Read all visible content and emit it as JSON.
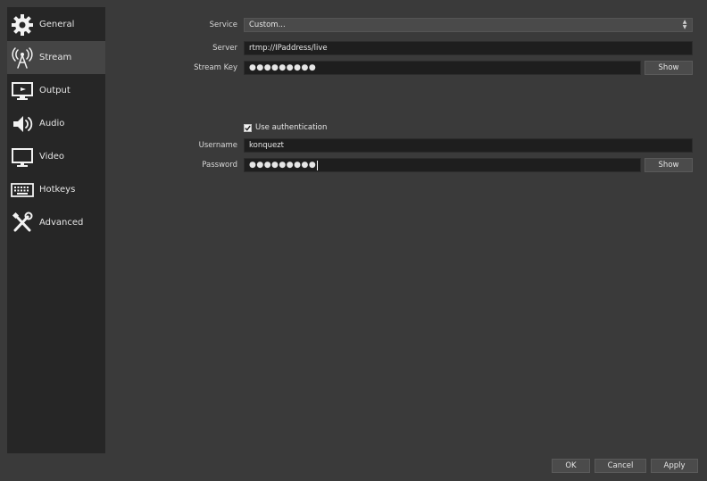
{
  "sidebar": {
    "items": [
      {
        "label": "General",
        "icon": "gear-icon"
      },
      {
        "label": "Stream",
        "icon": "antenna-icon"
      },
      {
        "label": "Output",
        "icon": "monitor-output-icon"
      },
      {
        "label": "Audio",
        "icon": "speaker-icon"
      },
      {
        "label": "Video",
        "icon": "monitor-icon"
      },
      {
        "label": "Hotkeys",
        "icon": "keyboard-icon"
      },
      {
        "label": "Advanced",
        "icon": "tools-icon"
      }
    ],
    "active": "Stream"
  },
  "stream": {
    "service_label": "Service",
    "service_value": "Custom...",
    "server_label": "Server",
    "server_value": "rtmp://IPaddress/live",
    "stream_key_label": "Stream Key",
    "stream_key_value": "●●●●●●●●●",
    "stream_key_show": "Show",
    "use_auth_label": "Use authentication",
    "use_auth_checked": true,
    "username_label": "Username",
    "username_value": "konquezt",
    "password_label": "Password",
    "password_value": "●●●●●●●●●",
    "password_show": "Show"
  },
  "footer": {
    "ok_label": "OK",
    "cancel_label": "Cancel",
    "apply_label": "Apply"
  },
  "colors": {
    "background": "#3a3a3a",
    "sidebar": "#262626",
    "active_item": "#454545",
    "field": "#1e1e1e",
    "button": "#4b4b4b"
  }
}
